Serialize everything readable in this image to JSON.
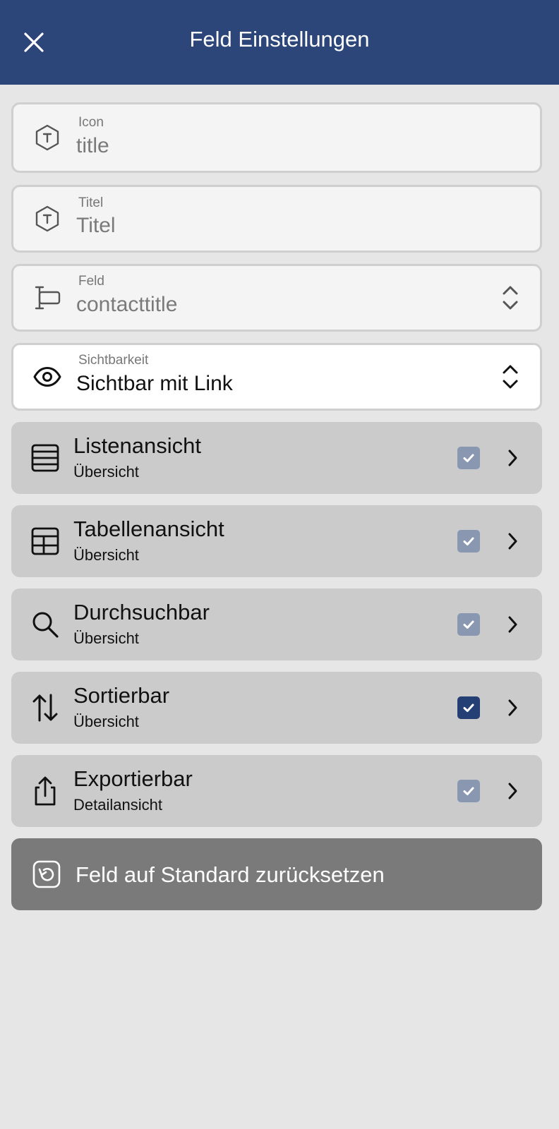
{
  "header": {
    "title": "Feld Einstellungen",
    "close_icon": "close-icon"
  },
  "fields": {
    "icon": {
      "label": "Icon",
      "value": "title",
      "icon": "title-hexagon-icon"
    },
    "title": {
      "label": "Titel",
      "value": "Titel",
      "icon": "title-hexagon-icon"
    },
    "field": {
      "label": "Feld",
      "value": "contacttitle",
      "icon": "text-field-icon"
    },
    "visibility": {
      "label": "Sichtbarkeit",
      "value": "Sichtbar mit Link",
      "icon": "eye-icon"
    }
  },
  "options": [
    {
      "title": "Listenansicht",
      "subtitle": "Übersicht",
      "icon": "list-icon",
      "checked": true,
      "checkbox_state": "checked-disabled"
    },
    {
      "title": "Tabellenansicht",
      "subtitle": "Übersicht",
      "icon": "table-icon",
      "checked": true,
      "checkbox_state": "checked-disabled"
    },
    {
      "title": "Durchsuchbar",
      "subtitle": "Übersicht",
      "icon": "search-icon",
      "checked": true,
      "checkbox_state": "checked-disabled"
    },
    {
      "title": "Sortierbar",
      "subtitle": "Übersicht",
      "icon": "sort-arrows-icon",
      "checked": true,
      "checkbox_state": "checked-active"
    },
    {
      "title": "Exportierbar",
      "subtitle": "Detailansicht",
      "icon": "share-export-icon",
      "checked": true,
      "checkbox_state": "checked-disabled"
    }
  ],
  "reset": {
    "label": "Feld auf Standard zurücksetzen",
    "icon": "reset-icon"
  },
  "colors": {
    "header": "#2c4679",
    "checkbox_active": "#233f74",
    "checkbox_disabled": "#8a97b0",
    "row_bg": "#cbcbcb",
    "reset_bg": "#7a7a7a"
  }
}
